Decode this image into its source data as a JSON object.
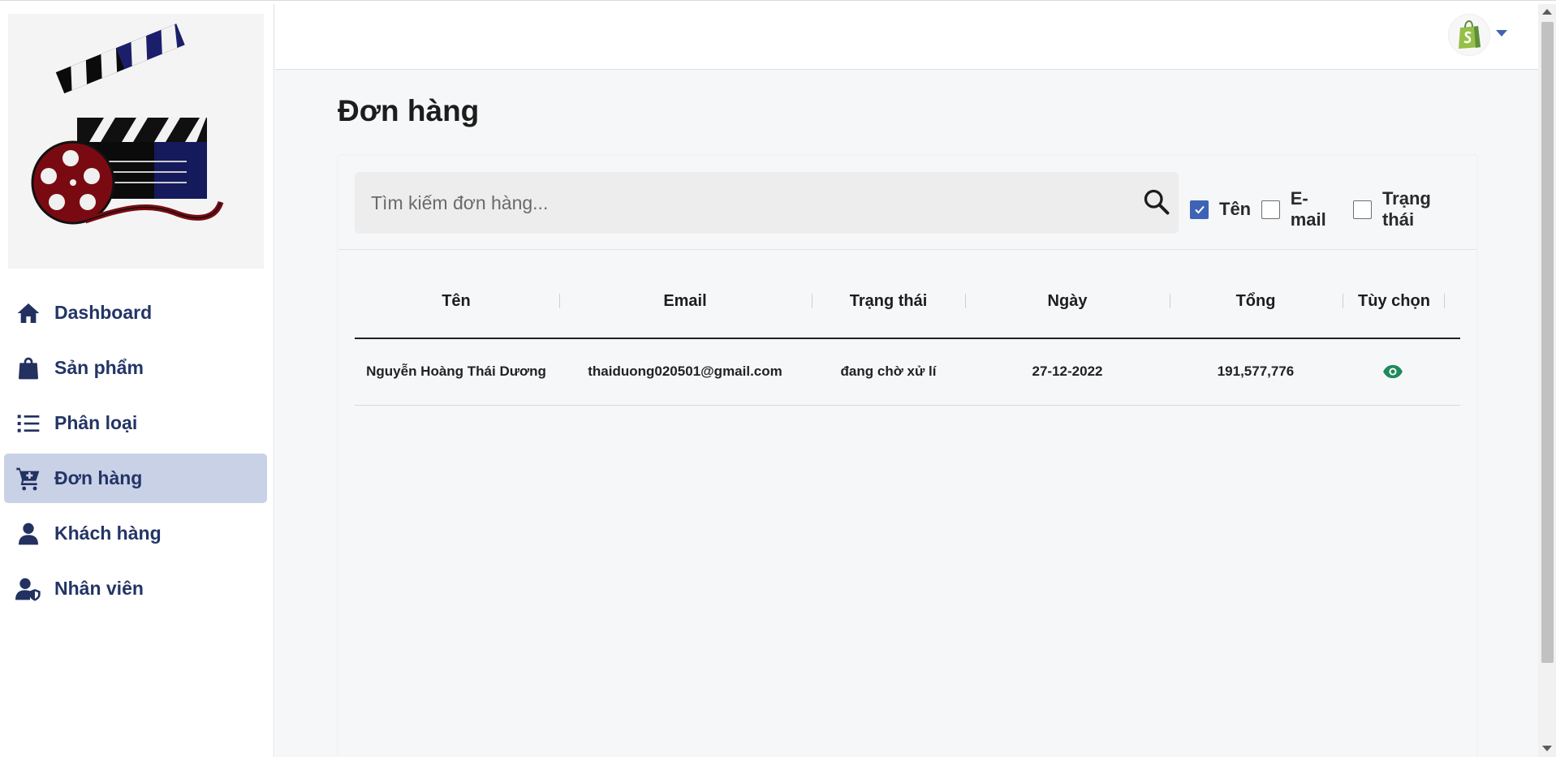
{
  "sidebar": {
    "items": [
      {
        "label": "Dashboard",
        "icon": "home-icon"
      },
      {
        "label": "Sản phẩm",
        "icon": "shopping-bag-icon"
      },
      {
        "label": "Phân loại",
        "icon": "list-icon"
      },
      {
        "label": "Đơn hàng",
        "icon": "cart-icon",
        "active": true
      },
      {
        "label": "Khách hàng",
        "icon": "user-icon"
      },
      {
        "label": "Nhân viên",
        "icon": "user-shield-icon"
      }
    ]
  },
  "header": {
    "avatar_icon": "shopify-bag-icon"
  },
  "main": {
    "title": "Đơn hàng",
    "search": {
      "placeholder": "Tìm kiếm đơn hàng...",
      "value": ""
    },
    "filters": [
      {
        "label": "Tên",
        "checked": true
      },
      {
        "label": "E-mail",
        "checked": false
      },
      {
        "label": "Trạng thái",
        "checked": false
      }
    ],
    "table": {
      "columns": [
        "Tên",
        "Email",
        "Trạng thái",
        "Ngày",
        "Tổng",
        "Tùy chọn"
      ],
      "rows": [
        {
          "name": "Nguyễn Hoàng Thái Dương",
          "email": "thaiduong020501@gmail.com",
          "status": "đang chờ xử lí",
          "date": "27-12-2022",
          "total": "191,577,776",
          "option_icon": "eye-icon"
        }
      ]
    }
  },
  "colors": {
    "accent": "#3e63b6",
    "nav_text": "#233566",
    "nav_active_bg": "#c9d1e6",
    "eye_icon": "#1f8a5b"
  }
}
